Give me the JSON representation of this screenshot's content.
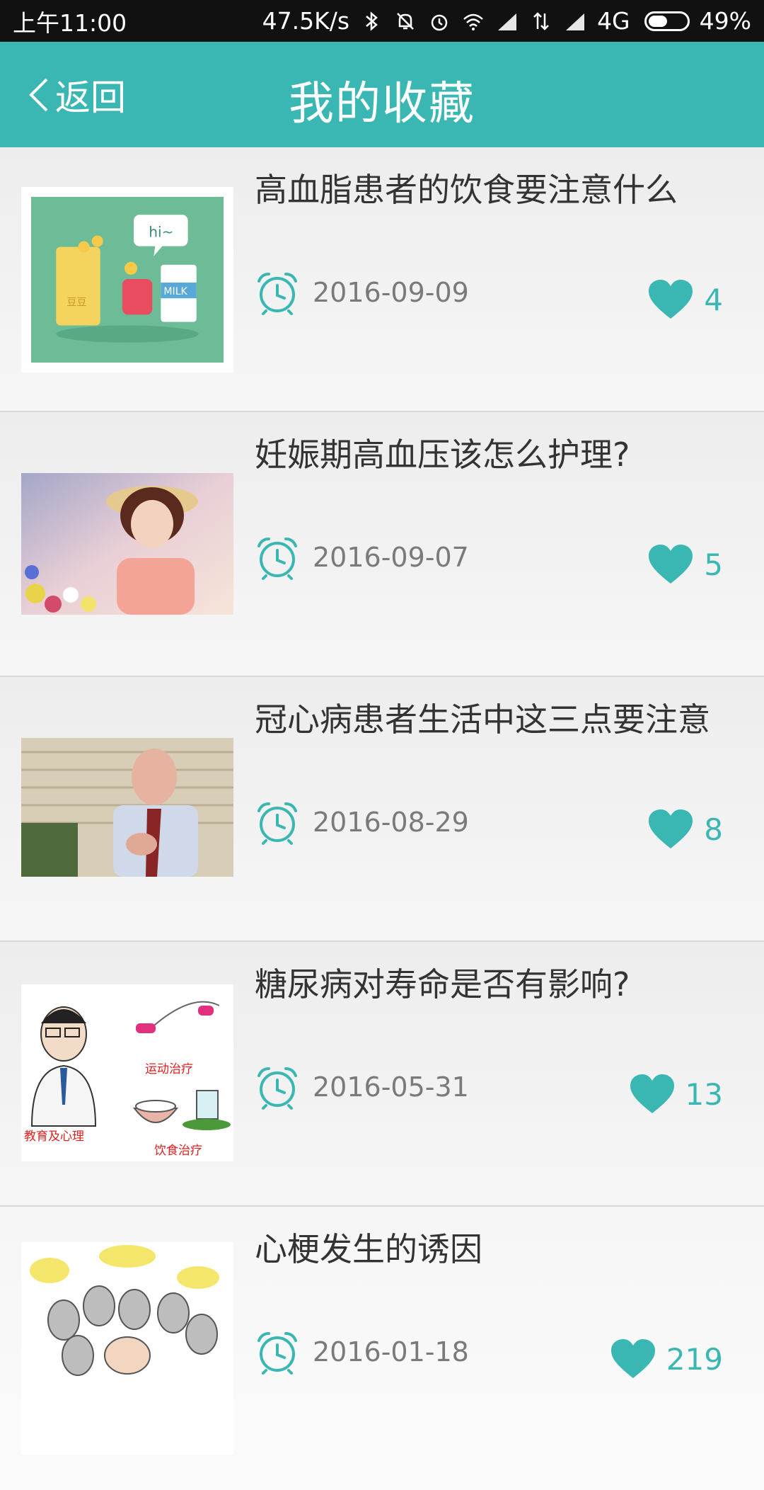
{
  "status_bar": {
    "time": "上午11:00",
    "speed": "47.5K/s",
    "network": "4G",
    "battery": "49%"
  },
  "header": {
    "back_label": "返回",
    "title": "我的收藏"
  },
  "colors": {
    "accent": "#3bb7b3"
  },
  "items": [
    {
      "title": "高血脂患者的饮食要注意什么",
      "date": "2016-09-09",
      "likes": "4"
    },
    {
      "title": "妊娠期高血压该怎么护理?",
      "date": "2016-09-07",
      "likes": "5"
    },
    {
      "title": "冠心病患者生活中这三点要注意",
      "date": "2016-08-29",
      "likes": "8"
    },
    {
      "title": "糖尿病对寿命是否有影响?",
      "date": "2016-05-31",
      "likes": "13"
    },
    {
      "title": "心梗发生的诱因",
      "date": "2016-01-18",
      "likes": "219"
    }
  ],
  "thumb_texts": {
    "item1": [
      "hi~",
      "MILK",
      "豆豆"
    ],
    "item4": [
      "运动治疗",
      "教育及心理",
      "饮食治疗"
    ]
  }
}
